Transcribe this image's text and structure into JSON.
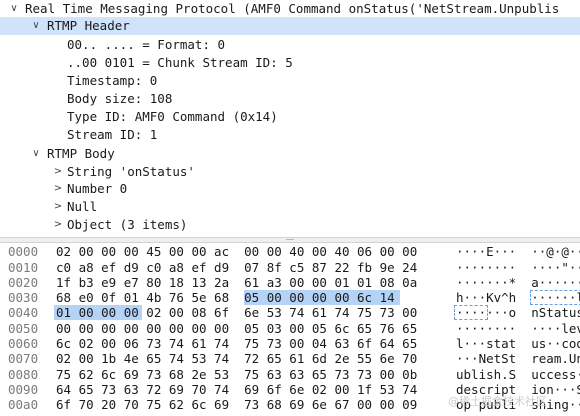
{
  "tree": {
    "rows": [
      {
        "text": "Real Time Messaging Protocol (AMF0 Command onStatus('NetStream.Unpublis",
        "arrow": "∨",
        "indent": 0,
        "selected": false
      },
      {
        "text": "RTMP Header",
        "arrow": "∨",
        "indent": 1,
        "selected": true
      },
      {
        "text": "00.. .... = Format: 0",
        "arrow": "",
        "indent": 2,
        "selected": false
      },
      {
        "text": "..00 0101 = Chunk Stream ID: 5",
        "arrow": "",
        "indent": 2,
        "selected": false
      },
      {
        "text": "Timestamp: 0",
        "arrow": "",
        "indent": 2,
        "selected": false
      },
      {
        "text": "Body size: 108",
        "arrow": "",
        "indent": 2,
        "selected": false
      },
      {
        "text": "Type ID: AMF0 Command (0x14)",
        "arrow": "",
        "indent": 2,
        "selected": false
      },
      {
        "text": "Stream ID: 1",
        "arrow": "",
        "indent": 2,
        "selected": false
      },
      {
        "text": "RTMP Body",
        "arrow": "∨",
        "indent": 1,
        "selected": false
      },
      {
        "text": "String 'onStatus'",
        "arrow": ">",
        "indent": 2,
        "selected": false
      },
      {
        "text": "Number 0",
        "arrow": ">",
        "indent": 2,
        "selected": false
      },
      {
        "text": "Null",
        "arrow": ">",
        "indent": 2,
        "selected": false
      },
      {
        "text": "Object (3 items)",
        "arrow": ">",
        "indent": 2,
        "selected": false
      }
    ]
  },
  "hex": {
    "rows": [
      {
        "offset": "0000",
        "bytes": "02 00 00 00 45 00 00 ac  00 00 40 00 40 06 00 00",
        "ascii": "····E···  ··@·@···"
      },
      {
        "offset": "0010",
        "bytes": "c0 a8 ef d9 c0 a8 ef d9  07 8f c5 87 22 fb 9e 24",
        "ascii": "········  ····\"··$"
      },
      {
        "offset": "0020",
        "bytes": "1f b3 e9 e7 80 18 13 2a  61 a3 00 00 01 01 08 0a",
        "ascii": "·······*  a·······"
      },
      {
        "offset": "0030",
        "bytes": "68 e0 0f 01 4b 76 5e 68  05 00 00 00 00 6c 14",
        "ascii": "h···Kv^h  ······l"
      },
      {
        "offset": "0040",
        "bytes": "01 00 00 00 02 00 08 6f  6e 53 74 61 74 75 73 00",
        "ascii": "·······o  nStatus·"
      },
      {
        "offset": "0050",
        "bytes": "00 00 00 00 00 00 00 00  05 03 00 05 6c 65 76 65",
        "ascii": "········  ····leve"
      },
      {
        "offset": "0060",
        "bytes": "6c 02 00 06 73 74 61 74  75 73 00 04 63 6f 64 65",
        "ascii": "l···stat  us··code"
      },
      {
        "offset": "0070",
        "bytes": "02 00 1b 4e 65 74 53 74  72 65 61 6d 2e 55 6e 70",
        "ascii": "···NetSt  ream.Unp"
      },
      {
        "offset": "0080",
        "bytes": "75 62 6c 69 73 68 2e 53  75 63 63 65 73 73 00 0b",
        "ascii": "ublish.S  uccess··"
      },
      {
        "offset": "0090",
        "bytes": "64 65 73 63 72 69 70 74  69 6f 6e 02 00 1f 53 74",
        "ascii": "descript  ion···St"
      },
      {
        "offset": "00a0",
        "bytes": "6f 70 20 70 75 62 6c 69  73 68 69 6e 67 00 00 09",
        "ascii": "op publi  shing···"
      }
    ]
  },
  "watermark": "@稀土掘金技术社区",
  "colors": {
    "selection": "#cfe3fb",
    "byte_highlight": "#b4d3f7"
  }
}
